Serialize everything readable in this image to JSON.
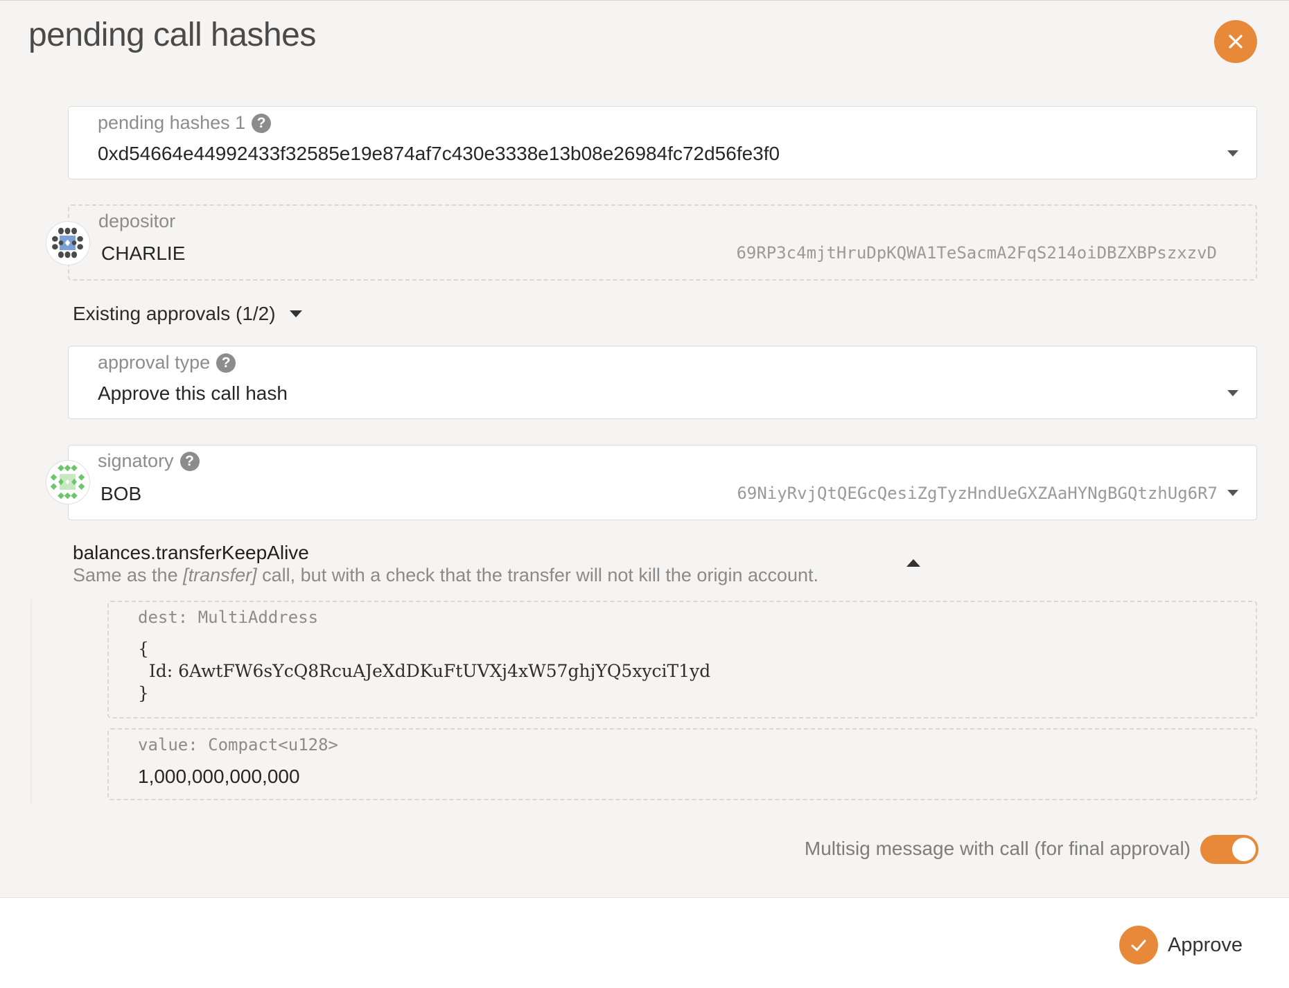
{
  "modal": {
    "title": "pending call hashes",
    "close_icon": "close-icon"
  },
  "pending_hashes": {
    "label": "pending hashes 1",
    "value": "0xd54664e44992433f32585e19e874af7c430e3338e13b08e26984fc72d56fe3f0"
  },
  "depositor": {
    "label": "depositor",
    "name": "CHARLIE",
    "address": "69RP3c4mjtHruDpKQWA1TeSacmA2FqS214oiDBZXBPszxzvD"
  },
  "existing_approvals": {
    "label": "Existing approvals (1/2)"
  },
  "approval_type": {
    "label": "approval type",
    "value": "Approve this call hash"
  },
  "signatory": {
    "label": "signatory",
    "name": "BOB",
    "address": "69NiyRvjQtQEGcQesiZgTyzHndUeGXZAaHYNgBGQtzhUg6R7"
  },
  "call": {
    "name": "balances.transferKeepAlive",
    "description_before": "Same as the ",
    "description_em": "[transfer]",
    "description_after": " call, but with a check that the transfer will not kill the origin account.",
    "params": [
      {
        "type": "dest: MultiAddress",
        "open_brace": "{",
        "id_line": "  Id: 6AwtFW6sYcQ8RcuAJeXdDKuFtUVXj4xW57ghjYQ5xyciT1yd",
        "close_brace": "}"
      },
      {
        "type": "value: Compact<u128>",
        "value": "1,000,000,000,000"
      }
    ]
  },
  "toggle": {
    "label": "Multisig message with call (for final approval)",
    "enabled": true
  },
  "footer": {
    "approve_label": "Approve"
  },
  "colors": {
    "accent": "#e8893a",
    "background": "#f5f4f3"
  }
}
